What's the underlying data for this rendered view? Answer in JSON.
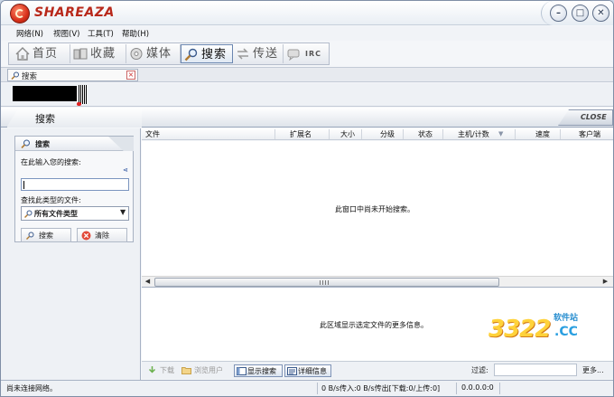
{
  "app": {
    "name": "SHAREAZA"
  },
  "menu": [
    "网络(N)",
    "视图(V)",
    "工具(T)",
    "帮助(H)"
  ],
  "nav_tabs": [
    {
      "label": "首页",
      "icon": "home-icon"
    },
    {
      "label": "收藏",
      "icon": "library-icon"
    },
    {
      "label": "媒体",
      "icon": "media-icon"
    },
    {
      "label": "搜索",
      "icon": "search-icon",
      "active": true
    },
    {
      "label": "传送",
      "icon": "transfers-icon"
    },
    {
      "label": "IRC",
      "icon": "irc-icon"
    }
  ],
  "doc_tab": {
    "label": "搜索"
  },
  "header": {
    "title": "搜索",
    "close_label": "CLOSE"
  },
  "search_panel": {
    "title": "搜索",
    "query_label": "在此输入您的搜索:",
    "query_value": "",
    "type_label": "查找此类型的文件:",
    "type_selected": "所有文件类型",
    "search_button": "搜索",
    "clear_button": "清除"
  },
  "grid": {
    "columns": [
      "文件",
      "扩展名",
      "大小",
      "分级",
      "状态",
      "主机/计数",
      "速度",
      "客户端"
    ],
    "rows": [],
    "empty_message": "此窗口中尚未开始搜索。"
  },
  "detail": {
    "empty_message": "此区域显示选定文件的更多信息。"
  },
  "watermark": {
    "number": "3322",
    "site": "软件站",
    "domain": ".CC"
  },
  "action_bar": {
    "download": "下载",
    "browse_user": "浏览用户",
    "show_search": "显示搜索",
    "details": "详细信息",
    "filter_label": "过滤:",
    "filter_value": "",
    "more": "更多..."
  },
  "status": {
    "network": "尚未连接网络。",
    "bandwidth": "0 B/s传入:0 B/s传出[下载:0/上传:0]",
    "ip": "0.0.0.0:0"
  },
  "colors": {
    "accent": "#b8281a",
    "frame": "#7f8ea6",
    "active_tab_border": "#6a86b0"
  }
}
